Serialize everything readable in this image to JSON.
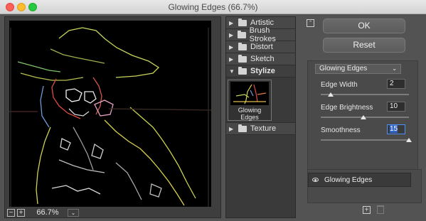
{
  "window": {
    "title": "Glowing Edges (66.7%)"
  },
  "preview": {
    "zoom_minus": "−",
    "zoom_plus": "+",
    "zoom_level": "66.7%",
    "zoom_dropdown": "⌄"
  },
  "gallery": {
    "categories": [
      {
        "label": "Artistic",
        "expanded": false
      },
      {
        "label": "Brush Strokes",
        "expanded": false
      },
      {
        "label": "Distort",
        "expanded": false
      },
      {
        "label": "Sketch",
        "expanded": false
      },
      {
        "label": "Stylize",
        "expanded": true
      },
      {
        "label": "Texture",
        "expanded": false
      }
    ],
    "selected_thumb_label": "Glowing Edges"
  },
  "controls": {
    "ok_label": "OK",
    "reset_label": "Reset",
    "filter_select": "Glowing Edges",
    "params": [
      {
        "label": "Edge Width",
        "value": "2",
        "slider_fraction": 0.11
      },
      {
        "label": "Edge Brightness",
        "value": "10",
        "slider_fraction": 0.48
      },
      {
        "label": "Smoothness",
        "value": "15",
        "slider_fraction": 1.0
      }
    ]
  },
  "layers": {
    "items": [
      {
        "label": "Glowing Edges"
      }
    ]
  },
  "colors": {
    "bg": "#535353",
    "panel": "#4a4a4a",
    "selection": "#2f64c6"
  }
}
